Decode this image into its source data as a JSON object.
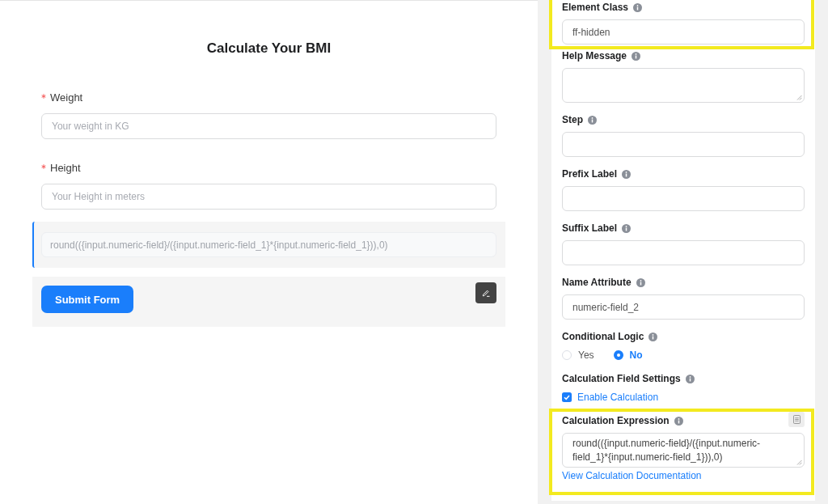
{
  "form": {
    "title": "Calculate Your BMI",
    "fields": [
      {
        "kind": "input",
        "label": "Weight",
        "required": true,
        "placeholder": "Your weight in KG",
        "selected": false
      },
      {
        "kind": "input",
        "label": "Height",
        "required": true,
        "placeholder": "Your Height in meters",
        "selected": false
      },
      {
        "kind": "calculation",
        "placeholder": "round(({input.numeric-field}/({input.numeric-field_1}*{input.numeric-field_1})),0)",
        "selected": true
      }
    ],
    "submit_button": "Submit Form"
  },
  "settings": {
    "groups": [
      {
        "kind": "input",
        "label": "Element Class",
        "value": "ff-hidden",
        "highlighted": true
      },
      {
        "kind": "textarea",
        "label": "Help Message",
        "highlighted": false
      },
      {
        "kind": "input",
        "label": "Step",
        "highlighted": false
      },
      {
        "kind": "input",
        "label": "Prefix Label",
        "highlighted": false
      },
      {
        "kind": "input",
        "label": "Suffix Label",
        "highlighted": false
      },
      {
        "kind": "input",
        "label": "Name Attribute",
        "value": "numeric-field_2",
        "highlighted": false
      },
      {
        "kind": "radio",
        "label": "Conditional Logic",
        "options": [
          {
            "label": "Yes",
            "selected": false
          },
          {
            "label": "No",
            "selected": true
          }
        ],
        "highlighted": false
      },
      {
        "kind": "checkbox",
        "label": "Calculation Field Settings",
        "option": {
          "label": "Enable Calculation",
          "checked": true
        },
        "highlighted": false
      },
      {
        "kind": "expression",
        "label": "Calculation Expression",
        "value": "round(({input.numeric-field}/({input.numeric-field_1}*{input.numeric-field_1})),0)",
        "link": "View Calculation Documentation",
        "highlighted": true
      }
    ]
  }
}
